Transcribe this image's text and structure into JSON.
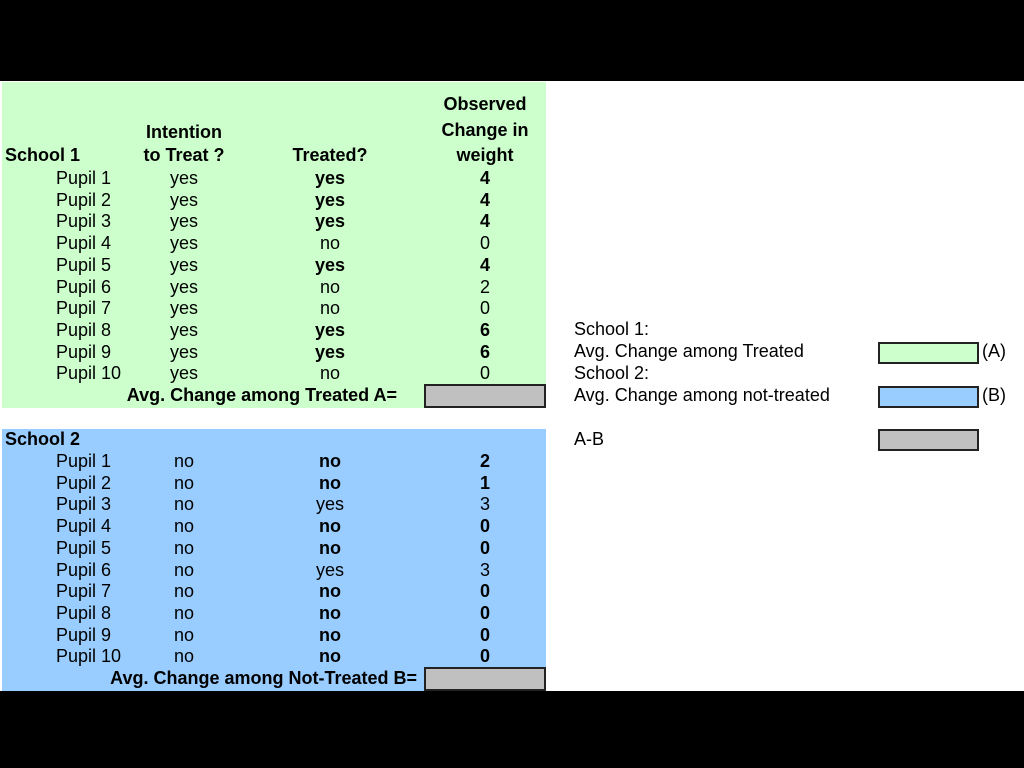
{
  "school1": {
    "title": "School 1",
    "headers": {
      "intention": [
        "Intention",
        "to Treat ?"
      ],
      "treated": "Treated?",
      "weight": [
        "Observed",
        "Change in",
        "weight"
      ]
    },
    "rows": [
      {
        "pupil": "Pupil 1",
        "intention": "yes",
        "treated": "yes",
        "weight": "4",
        "bold": true
      },
      {
        "pupil": "Pupil 2",
        "intention": "yes",
        "treated": "yes",
        "weight": "4",
        "bold": true
      },
      {
        "pupil": "Pupil 3",
        "intention": "yes",
        "treated": "yes",
        "weight": "4",
        "bold": true
      },
      {
        "pupil": "Pupil 4",
        "intention": "yes",
        "treated": "no",
        "weight": "0",
        "bold": false
      },
      {
        "pupil": "Pupil 5",
        "intention": "yes",
        "treated": "yes",
        "weight": "4",
        "bold": true
      },
      {
        "pupil": "Pupil 6",
        "intention": "yes",
        "treated": "no",
        "weight": "2",
        "bold": false
      },
      {
        "pupil": "Pupil 7",
        "intention": "yes",
        "treated": "no",
        "weight": "0",
        "bold": false
      },
      {
        "pupil": "Pupil 8",
        "intention": "yes",
        "treated": "yes",
        "weight": "6",
        "bold": true
      },
      {
        "pupil": "Pupil 9",
        "intention": "yes",
        "treated": "yes",
        "weight": "6",
        "bold": true
      },
      {
        "pupil": "Pupil 10",
        "intention": "yes",
        "treated": "no",
        "weight": "0",
        "bold": false
      }
    ],
    "avg_label": "Avg. Change among Treated A=",
    "color": "#ccffcc"
  },
  "school2": {
    "title": "School 2",
    "rows": [
      {
        "pupil": "Pupil 1",
        "intention": "no",
        "treated": "no",
        "weight": "2",
        "bold": true
      },
      {
        "pupil": "Pupil 2",
        "intention": "no",
        "treated": "no",
        "weight": "1",
        "bold": true
      },
      {
        "pupil": "Pupil 3",
        "intention": "no",
        "treated": "yes",
        "weight": "3",
        "bold": false
      },
      {
        "pupil": "Pupil 4",
        "intention": "no",
        "treated": "no",
        "weight": "0",
        "bold": true
      },
      {
        "pupil": "Pupil 5",
        "intention": "no",
        "treated": "no",
        "weight": "0",
        "bold": true
      },
      {
        "pupil": "Pupil 6",
        "intention": "no",
        "treated": "yes",
        "weight": "3",
        "bold": false
      },
      {
        "pupil": "Pupil 7",
        "intention": "no",
        "treated": "no",
        "weight": "0",
        "bold": true
      },
      {
        "pupil": "Pupil 8",
        "intention": "no",
        "treated": "no",
        "weight": "0",
        "bold": true
      },
      {
        "pupil": "Pupil 9",
        "intention": "no",
        "treated": "no",
        "weight": "0",
        "bold": true
      },
      {
        "pupil": "Pupil 10",
        "intention": "no",
        "treated": "no",
        "weight": "0",
        "bold": true
      }
    ],
    "avg_label": "Avg. Change among Not-Treated B=",
    "color": "#99ccff"
  },
  "summary": {
    "school1_label": "School 1:",
    "a_label": "Avg. Change among Treated",
    "a_tag": "(A)",
    "school2_label": "School 2:",
    "b_label": "Avg. Change among not-treated",
    "b_tag": "(B)",
    "diff_label": "A-B",
    "empty_color": "#c0c0c0"
  }
}
